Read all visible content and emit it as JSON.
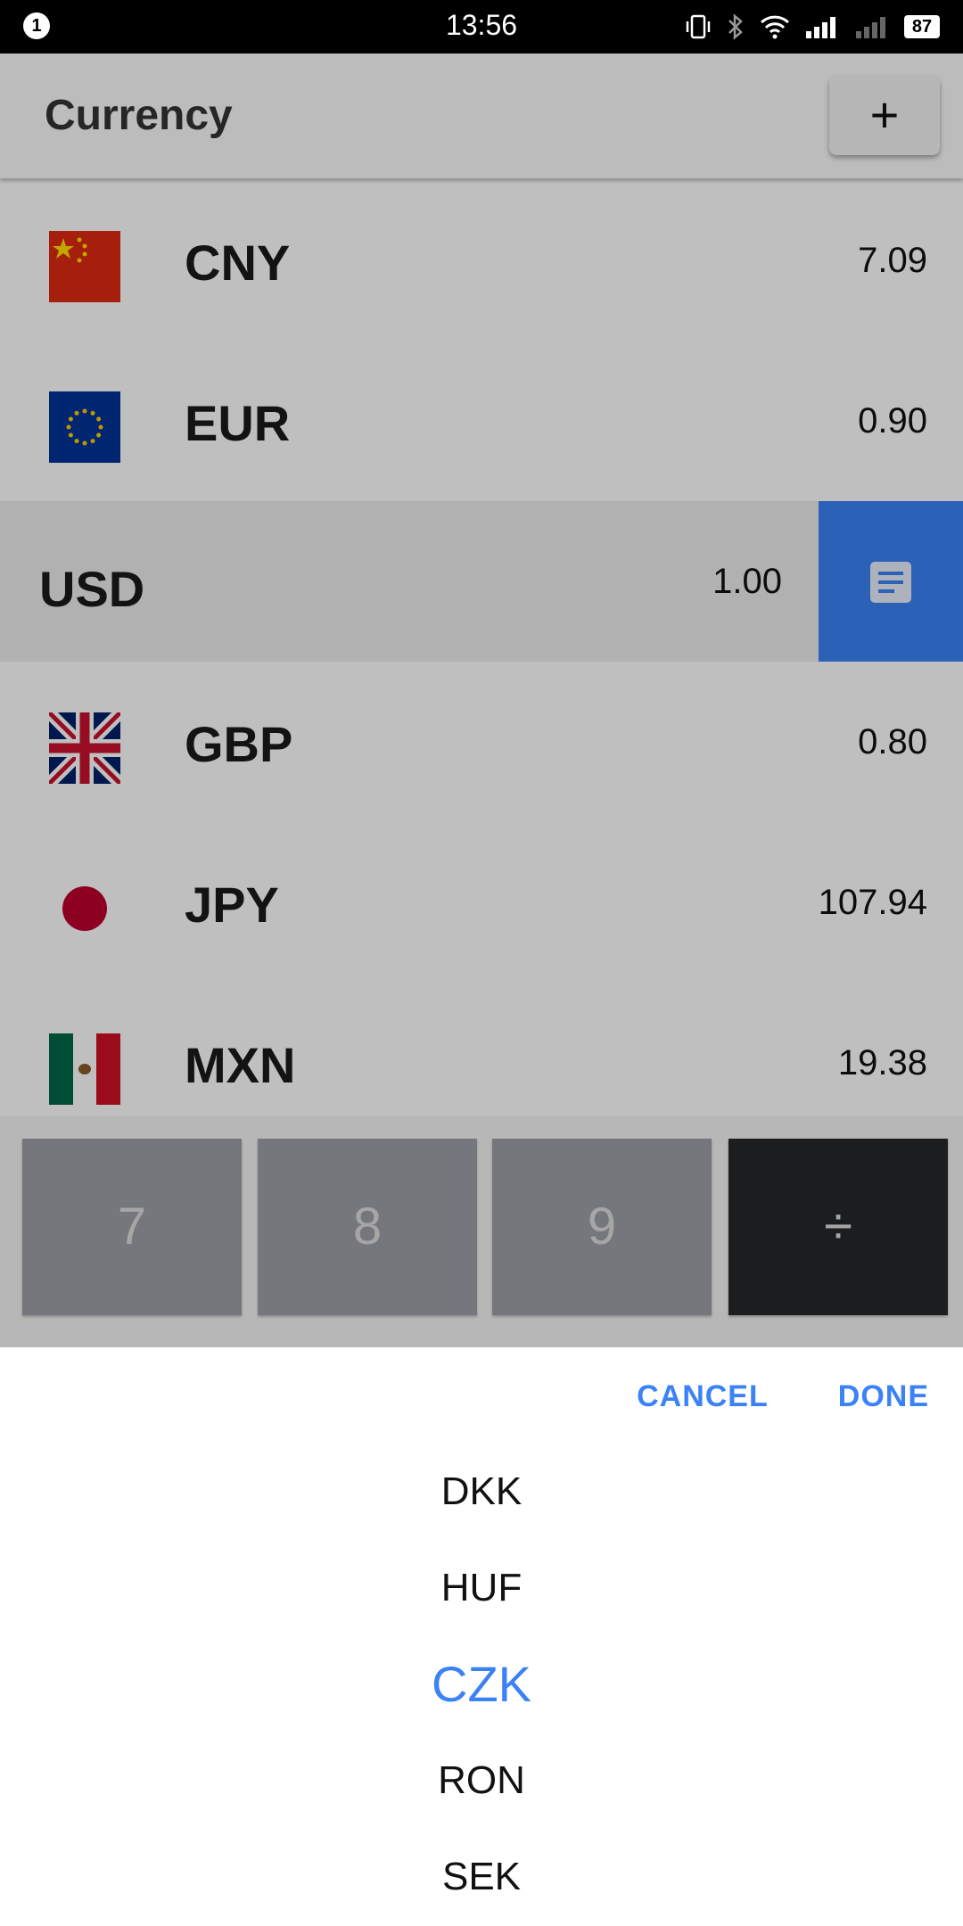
{
  "status_bar": {
    "notification_count": "1",
    "time": "13:56",
    "battery": "87"
  },
  "header": {
    "title": "Currency",
    "add_label": "+"
  },
  "rows": [
    {
      "code": "CNY",
      "value": "7.09",
      "flag_icon": "flag-cn-icon"
    },
    {
      "code": "EUR",
      "value": "0.90",
      "flag_icon": "flag-eu-icon"
    },
    {
      "code": "USD",
      "value": "1.00",
      "base": true
    },
    {
      "code": "GBP",
      "value": "0.80",
      "flag_icon": "flag-gb-icon"
    },
    {
      "code": "JPY",
      "value": "107.94",
      "flag_icon": "flag-jp-icon"
    },
    {
      "code": "MXN",
      "value": "19.38",
      "flag_icon": "flag-mx-icon"
    }
  ],
  "keypad": {
    "keys": [
      "7",
      "8",
      "9",
      "÷"
    ]
  },
  "picker": {
    "cancel_label": "CANCEL",
    "done_label": "DONE",
    "options": [
      "DKK",
      "HUF",
      "CZK",
      "RON",
      "SEK"
    ],
    "selected": "CZK"
  },
  "colors": {
    "accent": "#3b82f6",
    "key_gray": "#9e9fa6",
    "key_dark": "#262728"
  }
}
